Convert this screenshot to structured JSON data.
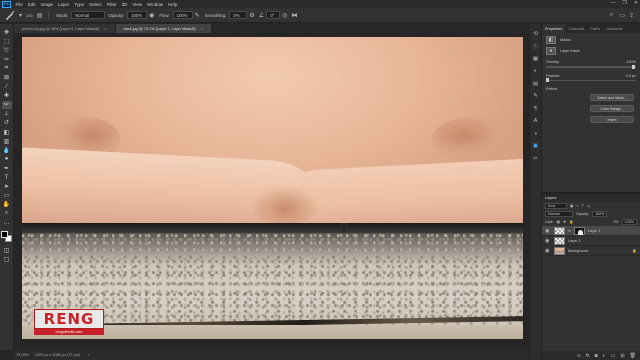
{
  "app": {
    "logo": "Ps"
  },
  "menu": [
    "File",
    "Edit",
    "Image",
    "Layer",
    "Type",
    "Select",
    "Filter",
    "3D",
    "View",
    "Window",
    "Help"
  ],
  "window_controls": [
    "—",
    "❐",
    "✕"
  ],
  "options": {
    "mode_label": "Mode:",
    "mode_value": "Normal",
    "opacity_label": "Opacity:",
    "opacity_value": "100%",
    "flow_label": "Flow:",
    "flow_value": "100%",
    "smoothing_label": "Smoothing:",
    "smoothing_value": "0%",
    "angle_value": "0°",
    "brush_size": "200"
  },
  "doc_tabs": [
    {
      "label": "pexels-kiy.jpg @ 38% (Layer 0, Layer Mask/8)",
      "active": false
    },
    {
      "label": "back.jpg @ 73.1% (Layer 1, Layer Mask/8)",
      "active": true
    }
  ],
  "status": {
    "zoom": "73.09%",
    "doc_size": "1920 px x 1080 px (72 ppi)"
  },
  "logo_text": {
    "brand": "RENG",
    "tagline": "renguterofix.com"
  },
  "properties": {
    "tabs": [
      "Properties",
      "Channels",
      "Paths",
      "Gradients"
    ],
    "mask_label": "Masks",
    "layer_mask": "Layer Mask",
    "density_label": "Density:",
    "density_value": "100%",
    "feather_label": "Feather:",
    "feather_value": "0.0 px",
    "refine_label": "Refine:",
    "select_mask_btn": "Select and Mask...",
    "color_range_btn": "Color Range...",
    "invert_btn": "Invert"
  },
  "layers": {
    "title": "Layers",
    "kind_label": "Kind",
    "blend_mode": "Normal",
    "opacity_label": "Opacity:",
    "opacity_value": "100%",
    "lock_label": "Lock:",
    "fill_label": "Fill:",
    "fill_value": "100%",
    "items": [
      {
        "name": "Layer 1",
        "active": true
      },
      {
        "name": "Layer 2",
        "active": false
      },
      {
        "name": "Background",
        "active": false
      }
    ]
  }
}
